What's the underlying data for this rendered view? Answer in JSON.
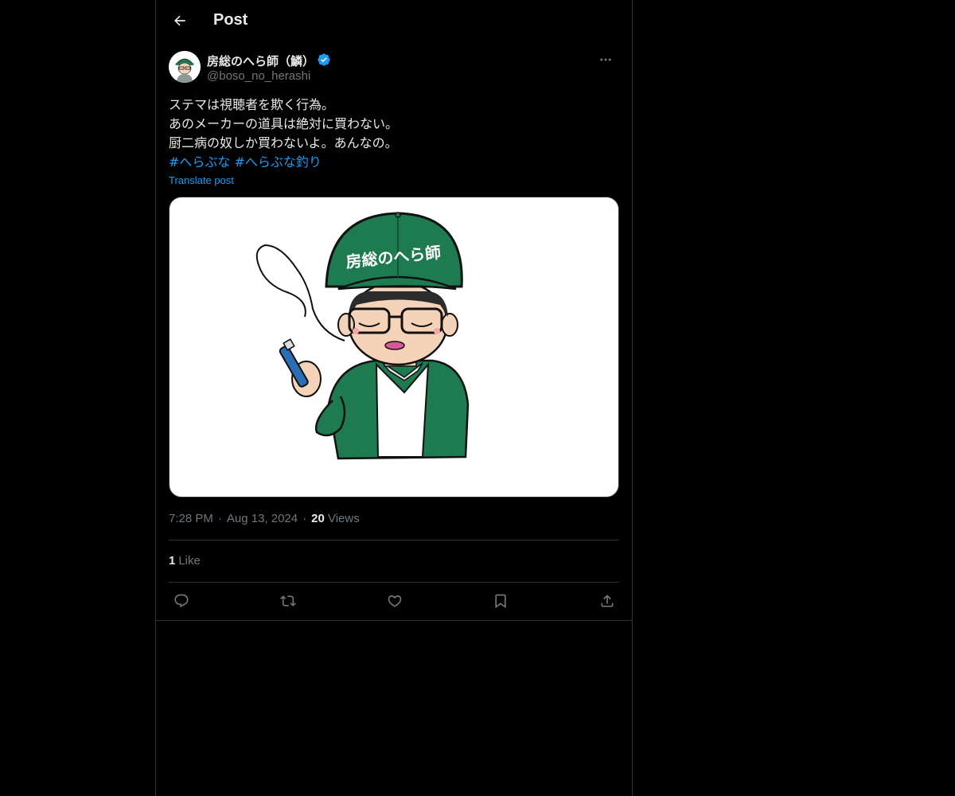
{
  "header": {
    "title": "Post",
    "back_icon": "arrow-left-icon"
  },
  "author": {
    "display_name": "房総のへら師（鱗）",
    "handle": "@boso_no_herashi",
    "verified": true,
    "verified_color": "#1d9bf0"
  },
  "tweet": {
    "lines": [
      "ステマは視聴者を欺く行為。",
      "あのメーカーの道具は絶対に買わない。",
      "厨二病の奴しか買わないよ。あんなの。"
    ],
    "hashtags": [
      "#へらぶな",
      "#へらぶな釣り"
    ],
    "translate_label": "Translate post"
  },
  "media": {
    "cap_text": "房総のへら師",
    "cap_color": "#1e7a4f"
  },
  "meta": {
    "time": "7:28 PM",
    "date": "Aug 13, 2024",
    "views_count": "20",
    "views_label": "Views"
  },
  "engagement": {
    "likes_count": "1",
    "likes_label": "Like"
  },
  "actions": [
    "reply-icon",
    "repost-icon",
    "like-icon",
    "bookmark-icon",
    "share-icon"
  ],
  "colors": {
    "background": "#000000",
    "text": "#e7e9ea",
    "muted": "#71767b",
    "accent": "#1d9bf0",
    "border": "#2f3336"
  }
}
